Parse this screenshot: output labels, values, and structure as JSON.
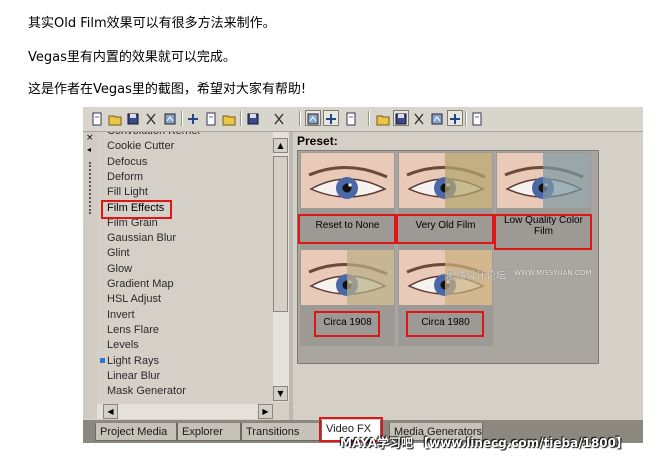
{
  "article": {
    "line1": "其实Old Film效果可以有很多方法来制作。",
    "line2": "Vegas里有内置的效果就可以完成。",
    "line3": "这是作者在Vegas里的截图，希望对大家有帮助!"
  },
  "toolbar": {
    "icons": [
      "new-file-icon",
      "open-folder-icon",
      "save-icon",
      "save-as-icon",
      "render-icon",
      "cut-icon",
      "copy-icon",
      "paste-icon",
      "undo-icon",
      "redo-icon",
      "normal-edit-tool-icon",
      "envelope-tool-icon",
      "selection-tool-icon",
      "snapping-icon",
      "auto-ripple-icon",
      "lock-envelopes-icon",
      "ignore-grouping-icon",
      "zoom-tool-icon",
      "properties-icon"
    ]
  },
  "fx_list": {
    "items": [
      "Convolution Kernel",
      "Cookie Cutter",
      "Defocus",
      "Deform",
      "Fill Light",
      "Film Effects",
      "Film Grain",
      "Gaussian Blur",
      "Glint",
      "Glow",
      "Gradient Map",
      "HSL Adjust",
      "Invert",
      "Lens Flare",
      "Levels",
      "Light Rays",
      "Linear Blur",
      "Mask Generator"
    ],
    "selected": "Film Effects"
  },
  "preset_panel": {
    "label": "Preset:",
    "presets": [
      {
        "name": "Reset to None",
        "style": "original"
      },
      {
        "name": "Very Old Film",
        "style": "old"
      },
      {
        "name": "Low Quality Color Film",
        "style": "lowq"
      },
      {
        "name": "Circa 1908",
        "style": "sepia"
      },
      {
        "name": "Circa 1980",
        "style": "warm"
      }
    ]
  },
  "tabs": {
    "items": [
      "Project Media",
      "Explorer",
      "Transitions",
      "Video FX",
      "Media Generators"
    ],
    "active": "Video FX"
  },
  "watermarks": {
    "site_cn": "思缘设计论坛",
    "site_url": "WWW.MISSYUAN.COM",
    "footer": "MAYA学习吧 【www.linecg.com/tieba/1800】"
  },
  "colors": {
    "highlight_red": "#e01515",
    "panel_gray": "#d4d0c8"
  }
}
